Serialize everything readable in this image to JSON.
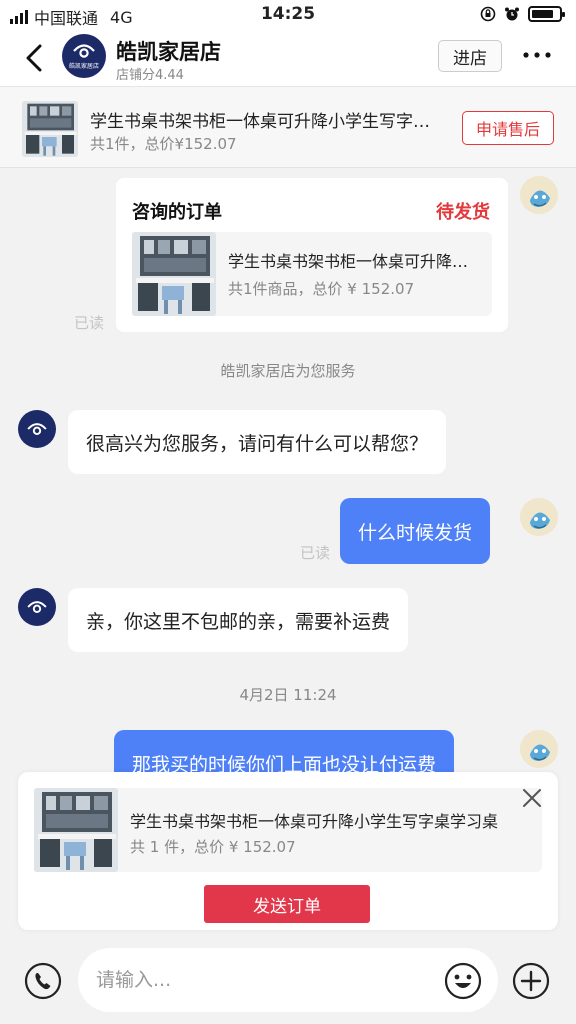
{
  "status_bar": {
    "carrier": "中国联通",
    "network": "4G",
    "time": "14:25",
    "battery_level": 0.8
  },
  "header": {
    "shop_name": "皓凯家居店",
    "shop_score": "店铺分4.44",
    "logo_text": "皓凯家居店",
    "enter_store_label": "进店",
    "more_label": "···",
    "back_icon": "chevron-left-icon"
  },
  "order_bar": {
    "title": "学生书桌书架书柜一体桌可升降小学生写字桌学习桌",
    "summary": "共1件，总价¥152.07",
    "after_sale_label": "申请售后"
  },
  "messages": {
    "order_card": {
      "title": "咨询的订单",
      "status": "待发货",
      "product_title": "学生书桌书架书柜一体桌可升降小学生写字桌学习桌",
      "product_summary": "共1件商品，总价 ¥ 152.07",
      "read": "已读"
    },
    "system_notice": "皓凯家居店为您服务",
    "shop_greeting": "很高兴为您服务，请问有什么可以帮您？",
    "user_question": "什么时候发货",
    "user_question_read": "已读",
    "shop_reply": "亲，你这里不包邮的亲，需要补运费",
    "timestamp": "4月2日 11:24",
    "user_followup": "那我买的时候你们上面也没让付运费"
  },
  "order_popup": {
    "product_title": "学生书桌书架书柜一体桌可升降小学生写字桌学习桌",
    "product_summary": "共 1 件，总价 ¥ 152.07",
    "send_label": "发送订单"
  },
  "input_bar": {
    "placeholder": "请输入..."
  },
  "colors": {
    "accent_red": "#e4393c",
    "bubble_blue": "#4e80f7",
    "shop_navy": "#1c2a68",
    "send_button": "#e2374a"
  }
}
